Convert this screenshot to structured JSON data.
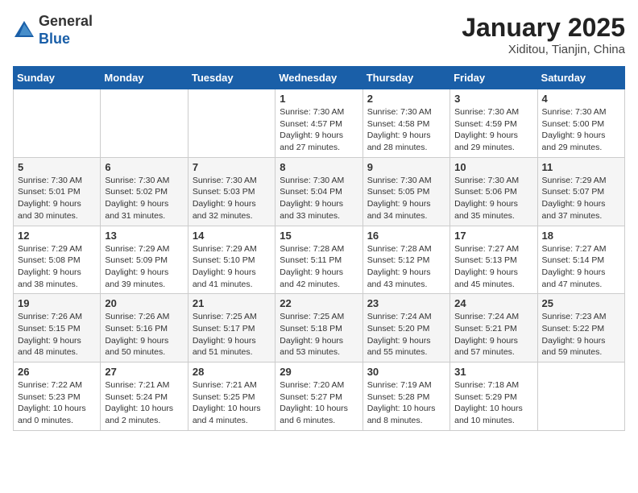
{
  "header": {
    "logo_general": "General",
    "logo_blue": "Blue",
    "title": "January 2025",
    "subtitle": "Xiditou, Tianjin, China"
  },
  "weekdays": [
    "Sunday",
    "Monday",
    "Tuesday",
    "Wednesday",
    "Thursday",
    "Friday",
    "Saturday"
  ],
  "weeks": [
    [
      {
        "day": "",
        "info": ""
      },
      {
        "day": "",
        "info": ""
      },
      {
        "day": "",
        "info": ""
      },
      {
        "day": "1",
        "info": "Sunrise: 7:30 AM\nSunset: 4:57 PM\nDaylight: 9 hours\nand 27 minutes."
      },
      {
        "day": "2",
        "info": "Sunrise: 7:30 AM\nSunset: 4:58 PM\nDaylight: 9 hours\nand 28 minutes."
      },
      {
        "day": "3",
        "info": "Sunrise: 7:30 AM\nSunset: 4:59 PM\nDaylight: 9 hours\nand 29 minutes."
      },
      {
        "day": "4",
        "info": "Sunrise: 7:30 AM\nSunset: 5:00 PM\nDaylight: 9 hours\nand 29 minutes."
      }
    ],
    [
      {
        "day": "5",
        "info": "Sunrise: 7:30 AM\nSunset: 5:01 PM\nDaylight: 9 hours\nand 30 minutes."
      },
      {
        "day": "6",
        "info": "Sunrise: 7:30 AM\nSunset: 5:02 PM\nDaylight: 9 hours\nand 31 minutes."
      },
      {
        "day": "7",
        "info": "Sunrise: 7:30 AM\nSunset: 5:03 PM\nDaylight: 9 hours\nand 32 minutes."
      },
      {
        "day": "8",
        "info": "Sunrise: 7:30 AM\nSunset: 5:04 PM\nDaylight: 9 hours\nand 33 minutes."
      },
      {
        "day": "9",
        "info": "Sunrise: 7:30 AM\nSunset: 5:05 PM\nDaylight: 9 hours\nand 34 minutes."
      },
      {
        "day": "10",
        "info": "Sunrise: 7:30 AM\nSunset: 5:06 PM\nDaylight: 9 hours\nand 35 minutes."
      },
      {
        "day": "11",
        "info": "Sunrise: 7:29 AM\nSunset: 5:07 PM\nDaylight: 9 hours\nand 37 minutes."
      }
    ],
    [
      {
        "day": "12",
        "info": "Sunrise: 7:29 AM\nSunset: 5:08 PM\nDaylight: 9 hours\nand 38 minutes."
      },
      {
        "day": "13",
        "info": "Sunrise: 7:29 AM\nSunset: 5:09 PM\nDaylight: 9 hours\nand 39 minutes."
      },
      {
        "day": "14",
        "info": "Sunrise: 7:29 AM\nSunset: 5:10 PM\nDaylight: 9 hours\nand 41 minutes."
      },
      {
        "day": "15",
        "info": "Sunrise: 7:28 AM\nSunset: 5:11 PM\nDaylight: 9 hours\nand 42 minutes."
      },
      {
        "day": "16",
        "info": "Sunrise: 7:28 AM\nSunset: 5:12 PM\nDaylight: 9 hours\nand 43 minutes."
      },
      {
        "day": "17",
        "info": "Sunrise: 7:27 AM\nSunset: 5:13 PM\nDaylight: 9 hours\nand 45 minutes."
      },
      {
        "day": "18",
        "info": "Sunrise: 7:27 AM\nSunset: 5:14 PM\nDaylight: 9 hours\nand 47 minutes."
      }
    ],
    [
      {
        "day": "19",
        "info": "Sunrise: 7:26 AM\nSunset: 5:15 PM\nDaylight: 9 hours\nand 48 minutes."
      },
      {
        "day": "20",
        "info": "Sunrise: 7:26 AM\nSunset: 5:16 PM\nDaylight: 9 hours\nand 50 minutes."
      },
      {
        "day": "21",
        "info": "Sunrise: 7:25 AM\nSunset: 5:17 PM\nDaylight: 9 hours\nand 51 minutes."
      },
      {
        "day": "22",
        "info": "Sunrise: 7:25 AM\nSunset: 5:18 PM\nDaylight: 9 hours\nand 53 minutes."
      },
      {
        "day": "23",
        "info": "Sunrise: 7:24 AM\nSunset: 5:20 PM\nDaylight: 9 hours\nand 55 minutes."
      },
      {
        "day": "24",
        "info": "Sunrise: 7:24 AM\nSunset: 5:21 PM\nDaylight: 9 hours\nand 57 minutes."
      },
      {
        "day": "25",
        "info": "Sunrise: 7:23 AM\nSunset: 5:22 PM\nDaylight: 9 hours\nand 59 minutes."
      }
    ],
    [
      {
        "day": "26",
        "info": "Sunrise: 7:22 AM\nSunset: 5:23 PM\nDaylight: 10 hours\nand 0 minutes."
      },
      {
        "day": "27",
        "info": "Sunrise: 7:21 AM\nSunset: 5:24 PM\nDaylight: 10 hours\nand 2 minutes."
      },
      {
        "day": "28",
        "info": "Sunrise: 7:21 AM\nSunset: 5:25 PM\nDaylight: 10 hours\nand 4 minutes."
      },
      {
        "day": "29",
        "info": "Sunrise: 7:20 AM\nSunset: 5:27 PM\nDaylight: 10 hours\nand 6 minutes."
      },
      {
        "day": "30",
        "info": "Sunrise: 7:19 AM\nSunset: 5:28 PM\nDaylight: 10 hours\nand 8 minutes."
      },
      {
        "day": "31",
        "info": "Sunrise: 7:18 AM\nSunset: 5:29 PM\nDaylight: 10 hours\nand 10 minutes."
      },
      {
        "day": "",
        "info": ""
      }
    ]
  ]
}
